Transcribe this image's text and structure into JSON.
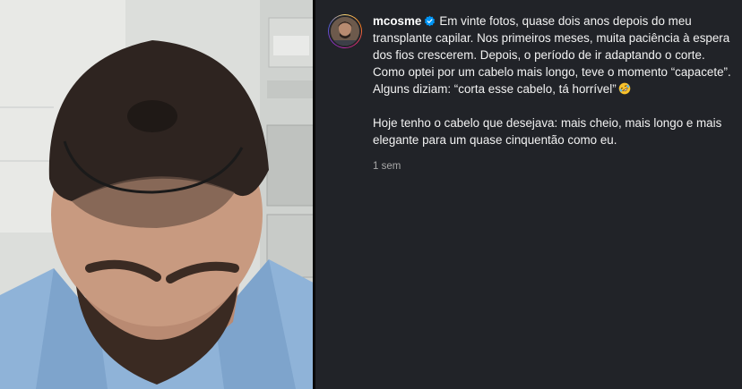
{
  "post": {
    "username": "mcosme",
    "caption_paragraph_1": "Em vinte fotos, quase dois anos depois do meu transplante capilar. Nos primeiros meses, muita paciência à espera dos fios crescerem. Depois, o período de ir adaptando o corte. Como optei por um cabelo mais longo, teve o momento “capacete”. Alguns diziam: “corta esse cabelo, tá horrível”",
    "caption_paragraph_2": "Hoje tenho o cabelo que desejava: mais cheio, mais longo e mais elegante para um quase cinquentão como eu.",
    "timestamp": "1 sem",
    "emoji": "rolling-on-floor-laughing",
    "verified": true
  },
  "colors": {
    "panel_bg": "#212328",
    "text": "#f2f2f2",
    "muted": "#a8a8a8",
    "verified_blue": "#0095f6"
  }
}
